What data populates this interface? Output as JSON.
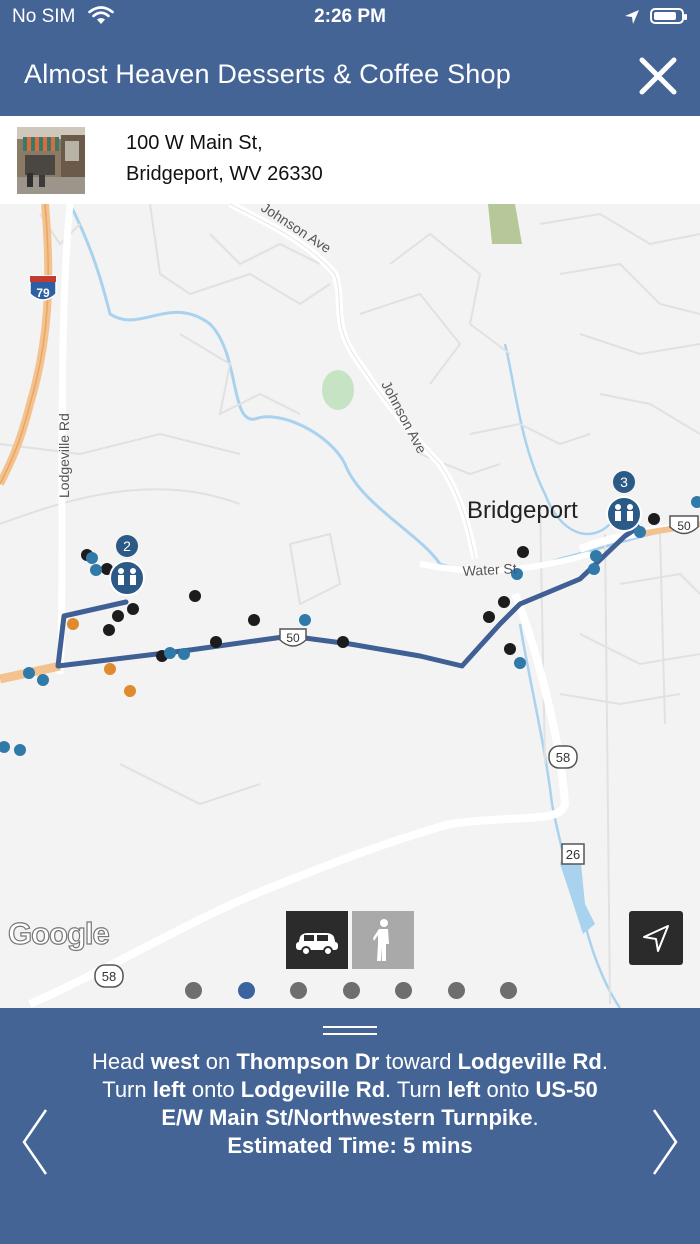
{
  "status": {
    "carrier": "No SIM",
    "time": "2:26 PM"
  },
  "header": {
    "title": "Almost Heaven Desserts & Coffee Shop",
    "close_icon": "close-icon"
  },
  "address": {
    "line1": "100 W Main St,",
    "line2": "Bridgeport, WV 26330"
  },
  "map": {
    "town": "Bridgeport",
    "roads": {
      "johnson_ave_top": "Johnson Ave",
      "johnson_ave": "Johnson Ave",
      "lodgeville_rd": "Lodgeville Rd",
      "water_st": "Water St"
    },
    "shields": {
      "i79": "79",
      "us50_a": "50",
      "us50_b": "50",
      "wv58_a": "58",
      "wv58_b": "58",
      "rt26": "26"
    },
    "markers": {
      "m2": "2",
      "m3": "3"
    },
    "logo": "Google"
  },
  "modes": {
    "car": "car-icon",
    "walk": "walk-icon",
    "selected": "car"
  },
  "pager": {
    "count": 7,
    "active_index": 1
  },
  "directions": {
    "parts": [
      {
        "t": "Head ",
        "b": false
      },
      {
        "t": "west",
        "b": true
      },
      {
        "t": " on ",
        "b": false
      },
      {
        "t": "Thompson Dr",
        "b": true
      },
      {
        "t": " toward ",
        "b": false
      },
      {
        "t": "Lodgeville Rd",
        "b": true
      },
      {
        "t": ". Turn ",
        "b": false
      },
      {
        "t": "left",
        "b": true
      },
      {
        "t": " onto ",
        "b": false
      },
      {
        "t": "Lodgeville Rd",
        "b": true
      },
      {
        "t": ". Turn ",
        "b": false
      },
      {
        "t": "left",
        "b": true
      },
      {
        "t": " onto ",
        "b": false
      },
      {
        "t": "US-50 E/W Main St/Northwestern Turnpike",
        "b": true
      },
      {
        "t": ".",
        "b": false
      }
    ],
    "estimate": "Estimated Time: 5 mins"
  },
  "colors": {
    "header": "#456496",
    "route": "#3f5f95",
    "poi_black": "#1c1c1c",
    "poi_blue": "#2f7aa8",
    "poi_orange": "#e08a2e"
  }
}
